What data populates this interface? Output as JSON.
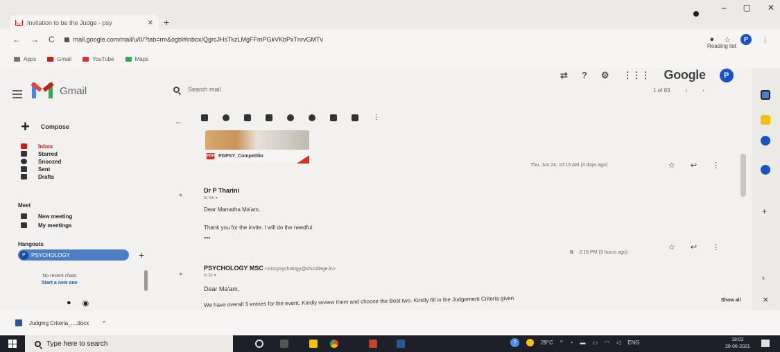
{
  "browser": {
    "tab_title": "Invitation to be the Judge - psy",
    "tab_close": "✕",
    "new_tab": "+",
    "url": "mail.google.com/mail/u/0/?tab=rm&ogbl#inbox/QgrcJHsTkzLMgFFmPGkVKbPxTnrvGMTv",
    "reading_list": "Reading list",
    "profile_initial": "P",
    "bookmarks": [
      "Apps",
      "Gmail",
      "YouTube",
      "Maps"
    ]
  },
  "gmail": {
    "logo_text": "Gmail",
    "search_placeholder": "Search mail",
    "google_word": "Google",
    "pager": "1 of 83",
    "compose": "Compose",
    "nav": [
      "Inbox",
      "Starred",
      "Snoozed",
      "Sent",
      "Drafts"
    ],
    "meet_heading": "Meet",
    "meet_items": [
      "New meeting",
      "My meetings"
    ],
    "hangouts_heading": "Hangouts",
    "hangouts_user": "PSYCHOLOGY",
    "hangouts_initial": "P",
    "no_chats": "No recent chats",
    "start_chat": "Start a new one"
  },
  "thread": {
    "attachment_name": "PGPSY_Competitio",
    "messages": [
      {
        "date": "Thu, Jun 24, 10:15 AM (4 days ago)",
        "sender": "Dr P Tharini",
        "to": "to me ▾",
        "greeting": "Dear Mamatha Ma'am,",
        "body": "Thank you for the invite. I will do the needful",
        "dots": "•••"
      },
      {
        "date": "2:19 PM (3 hours ago)",
        "sender": "PSYCHOLOGY MSC",
        "email": "<mscpsychology@sfscollege.in>",
        "to": "to Dr ▾",
        "greeting": "Dear Ma'am,",
        "body": "We have overall 3 entries for the event. Kindly review them and choose the Best two. Kindly fill in the Judgement Criteria given"
      }
    ]
  },
  "downloads": {
    "file": "Judging Criteria_....docx",
    "show_all": "Show all"
  },
  "taskbar": {
    "search_placeholder": "Type here to search",
    "temperature": "29°C",
    "language": "ENG",
    "time": "18:02",
    "date": "28-06-2021"
  }
}
